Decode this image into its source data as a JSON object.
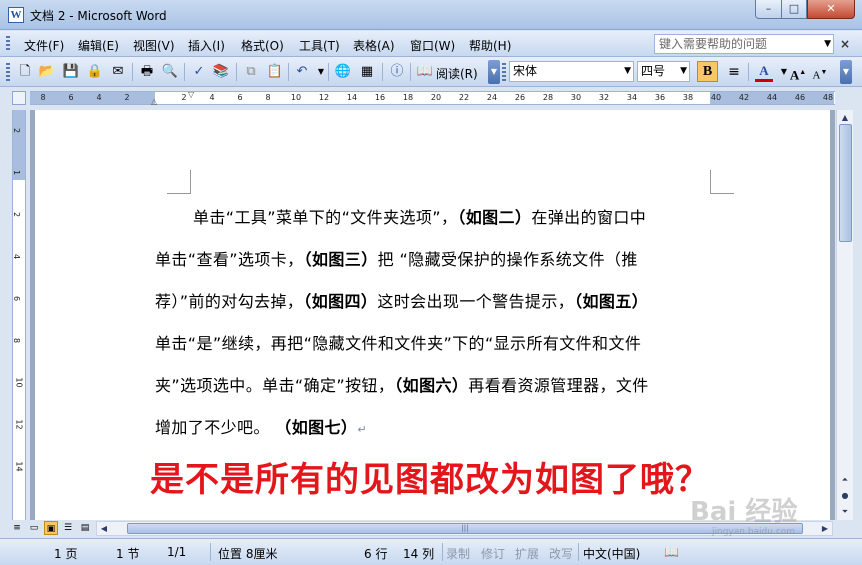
{
  "window": {
    "title": "文档 2 - Microsoft Word",
    "app_icon": "W",
    "minimize_label": "–",
    "maximize_label": "□",
    "close_label": "✕"
  },
  "menu": {
    "items": [
      "文件(F)",
      "编辑(E)",
      "视图(V)",
      "插入(I)",
      "格式(O)",
      "工具(T)",
      "表格(A)",
      "窗口(W)",
      "帮助(H)"
    ],
    "help_placeholder": "键入需要帮助的问题",
    "close_label": "×"
  },
  "toolbar": {
    "read_label": "阅读(R)",
    "font_name": "宋体",
    "font_size": "四号",
    "bold_label": "B",
    "font_color": "#cc0000"
  },
  "ruler": {
    "horizontal_labels": [
      "8",
      "6",
      "4",
      "2",
      "2",
      "4",
      "6",
      "8",
      "10",
      "12",
      "14",
      "16",
      "18",
      "20",
      "22",
      "24",
      "26",
      "28",
      "30",
      "32",
      "34",
      "36",
      "38",
      "40",
      "42",
      "44",
      "46",
      "48"
    ],
    "vertical_labels": [
      "2",
      "1",
      "2",
      "4",
      "6",
      "8",
      "10",
      "12",
      "14"
    ]
  },
  "document": {
    "lines": [
      {
        "segments": [
          {
            "text": "单击“工具”菜单下的“文件夹选项”，",
            "bold": false
          },
          {
            "text": "（如图二）",
            "bold": true
          },
          {
            "text": "在弹出的窗口中",
            "bold": false
          }
        ]
      },
      {
        "segments": [
          {
            "text": "单击“查看”选项卡，",
            "bold": false
          },
          {
            "text": "（如图三）",
            "bold": true
          },
          {
            "text": "把 “隐藏受保护的操作系统文件（推",
            "bold": false
          }
        ]
      },
      {
        "segments": [
          {
            "text": "荐）”前的对勾去掉，",
            "bold": false
          },
          {
            "text": "（如图四）",
            "bold": true
          },
          {
            "text": "这时会出现一个警告提示，",
            "bold": false
          },
          {
            "text": "（如图五）",
            "bold": true
          }
        ]
      },
      {
        "segments": [
          {
            "text": "单击“是”继续，再把“隐藏文件和文件夹”下的“显示所有文件和文件",
            "bold": false
          }
        ]
      },
      {
        "segments": [
          {
            "text": "夹”选项选中。单击“确定”按钮，",
            "bold": false
          },
          {
            "text": "（如图六）",
            "bold": true
          },
          {
            "text": "再看看资源管理器，文件",
            "bold": false
          }
        ]
      },
      {
        "segments": [
          {
            "text": "增加了不少吧。 ",
            "bold": false
          },
          {
            "text": "（如图七）",
            "bold": true
          }
        ]
      }
    ],
    "paragraph_mark": "↵",
    "overlay_text": "是不是所有的见图都改为如图了哦？"
  },
  "status": {
    "page": "1 页",
    "section": "1 节",
    "page_of": "1/1",
    "position": "位置 8厘米",
    "line": "6 行",
    "column": "14 列",
    "rec": "录制",
    "trk": "修订",
    "ext": "扩展",
    "ovr": "改写",
    "language": "中文(中国)"
  },
  "watermark": {
    "text": "Bai 经验",
    "sub": "jingyan.baidu.com"
  }
}
